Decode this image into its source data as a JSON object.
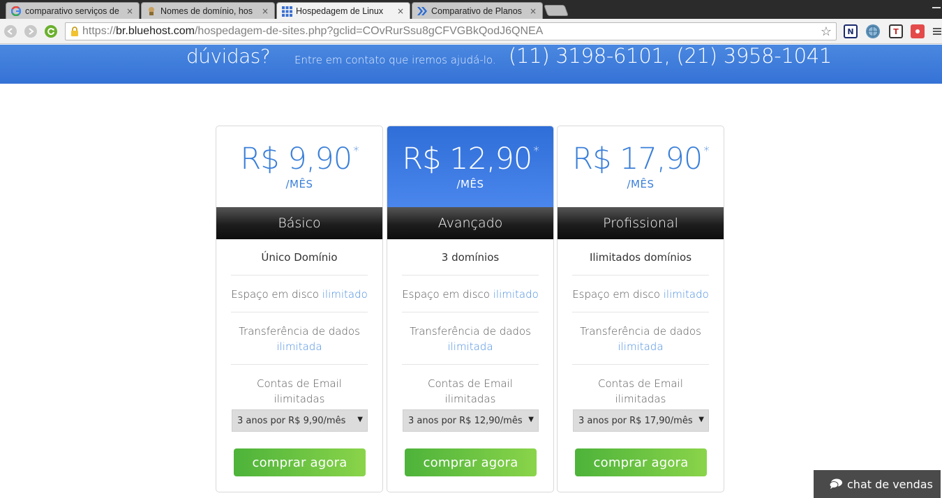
{
  "browser": {
    "tabs": [
      {
        "title": "comparativo serviços de",
        "icon": "google-g-icon",
        "active": false
      },
      {
        "title": "Nomes de domínio, hos",
        "icon": "gnu-icon",
        "active": false
      },
      {
        "title": "Hospedagem de Linux",
        "icon": "grid-icon",
        "active": true
      },
      {
        "title": "Comparativo de Planos",
        "icon": "chevron-logo-icon",
        "active": false
      }
    ],
    "tab_close": "×",
    "url_scheme": "https://",
    "url_host": "br.bluehost.com",
    "url_path": "/hospedagem-de-sites.php?gclid=COvRurSsu8gCFVGBkQodJ6QNEA",
    "extensions": [
      {
        "label": "N",
        "bg": "#ffffff",
        "fg": "#1a2a6c"
      },
      {
        "label": "",
        "bg": "#5a8fb8",
        "fg": "#ffffff"
      },
      {
        "label": "T",
        "bg": "#ffffff",
        "fg": "#c62828"
      },
      {
        "label": "",
        "bg": "#e44a4a",
        "fg": "#ffffff"
      }
    ]
  },
  "banner": {
    "question": "dúvidas?",
    "contact": "Entre em contato que iremos ajudá-lo.",
    "phones": "(11) 3198-6101, (21) 3958-1041"
  },
  "plans": [
    {
      "price": "R$ 9,90",
      "asterisk": "*",
      "period": "/MÊS",
      "name": "Básico",
      "featured": false,
      "domains": "Único Domínio",
      "disk_label": "Espaço em disco",
      "disk_value": "ilimitado",
      "transfer_label": "Transferência de dados",
      "transfer_value": "ilimitada",
      "email": "Contas de Email ilimitadas",
      "term": "3 anos por R$ 9,90/mês",
      "buy": "comprar agora"
    },
    {
      "price": "R$ 12,90",
      "asterisk": "*",
      "period": "/MÊS",
      "name": "Avançado",
      "featured": true,
      "domains": "3 domínios",
      "disk_label": "Espaço em disco",
      "disk_value": "ilimitado",
      "transfer_label": "Transferência de dados",
      "transfer_value": "ilimitada",
      "email": "Contas de Email ilimitadas",
      "term": "3 anos por R$ 12,90/mês",
      "buy": "comprar agora"
    },
    {
      "price": "R$ 17,90",
      "asterisk": "*",
      "period": "/MÊS",
      "name": "Profissional",
      "featured": false,
      "domains": "Ilimitados domínios",
      "disk_label": "Espaço em disco",
      "disk_value": "ilimitado",
      "transfer_label": "Transferência de dados",
      "transfer_value": "ilimitada",
      "email": "Contas de Email ilimitadas",
      "term": "3 anos por R$ 17,90/mês",
      "buy": "comprar agora"
    }
  ],
  "dropdown_arrow": "▼",
  "chat": {
    "label": "chat de vendas"
  },
  "colors": {
    "accent": "#3a7fd9",
    "banner": "#3f7ddb",
    "buy_green": "#6cc43f",
    "link": "#4a8de0"
  }
}
